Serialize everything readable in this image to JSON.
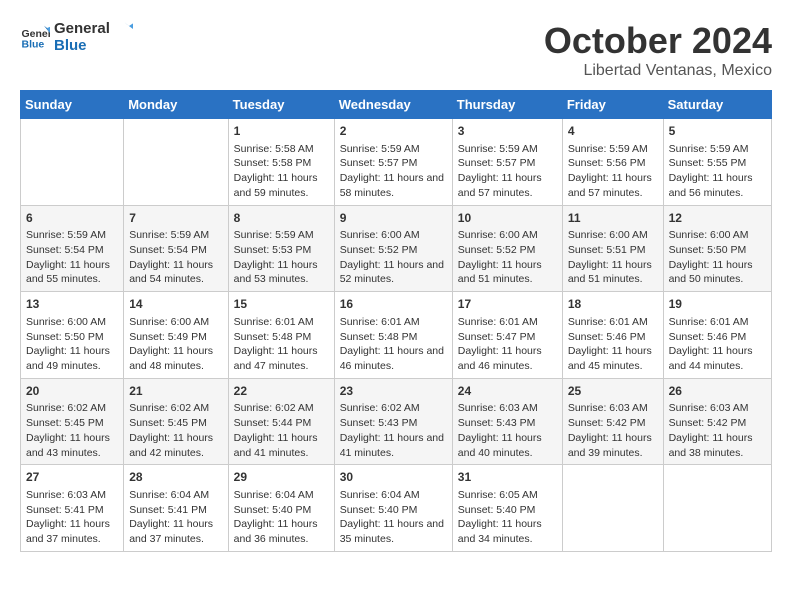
{
  "header": {
    "logo_general": "General",
    "logo_blue": "Blue",
    "month": "October 2024",
    "location": "Libertad Ventanas, Mexico"
  },
  "weekdays": [
    "Sunday",
    "Monday",
    "Tuesday",
    "Wednesday",
    "Thursday",
    "Friday",
    "Saturday"
  ],
  "weeks": [
    [
      {
        "day": "",
        "content": ""
      },
      {
        "day": "",
        "content": ""
      },
      {
        "day": "1",
        "content": "Sunrise: 5:58 AM\nSunset: 5:58 PM\nDaylight: 11 hours and 59 minutes."
      },
      {
        "day": "2",
        "content": "Sunrise: 5:59 AM\nSunset: 5:57 PM\nDaylight: 11 hours and 58 minutes."
      },
      {
        "day": "3",
        "content": "Sunrise: 5:59 AM\nSunset: 5:57 PM\nDaylight: 11 hours and 57 minutes."
      },
      {
        "day": "4",
        "content": "Sunrise: 5:59 AM\nSunset: 5:56 PM\nDaylight: 11 hours and 57 minutes."
      },
      {
        "day": "5",
        "content": "Sunrise: 5:59 AM\nSunset: 5:55 PM\nDaylight: 11 hours and 56 minutes."
      }
    ],
    [
      {
        "day": "6",
        "content": "Sunrise: 5:59 AM\nSunset: 5:54 PM\nDaylight: 11 hours and 55 minutes."
      },
      {
        "day": "7",
        "content": "Sunrise: 5:59 AM\nSunset: 5:54 PM\nDaylight: 11 hours and 54 minutes."
      },
      {
        "day": "8",
        "content": "Sunrise: 5:59 AM\nSunset: 5:53 PM\nDaylight: 11 hours and 53 minutes."
      },
      {
        "day": "9",
        "content": "Sunrise: 6:00 AM\nSunset: 5:52 PM\nDaylight: 11 hours and 52 minutes."
      },
      {
        "day": "10",
        "content": "Sunrise: 6:00 AM\nSunset: 5:52 PM\nDaylight: 11 hours and 51 minutes."
      },
      {
        "day": "11",
        "content": "Sunrise: 6:00 AM\nSunset: 5:51 PM\nDaylight: 11 hours and 51 minutes."
      },
      {
        "day": "12",
        "content": "Sunrise: 6:00 AM\nSunset: 5:50 PM\nDaylight: 11 hours and 50 minutes."
      }
    ],
    [
      {
        "day": "13",
        "content": "Sunrise: 6:00 AM\nSunset: 5:50 PM\nDaylight: 11 hours and 49 minutes."
      },
      {
        "day": "14",
        "content": "Sunrise: 6:00 AM\nSunset: 5:49 PM\nDaylight: 11 hours and 48 minutes."
      },
      {
        "day": "15",
        "content": "Sunrise: 6:01 AM\nSunset: 5:48 PM\nDaylight: 11 hours and 47 minutes."
      },
      {
        "day": "16",
        "content": "Sunrise: 6:01 AM\nSunset: 5:48 PM\nDaylight: 11 hours and 46 minutes."
      },
      {
        "day": "17",
        "content": "Sunrise: 6:01 AM\nSunset: 5:47 PM\nDaylight: 11 hours and 46 minutes."
      },
      {
        "day": "18",
        "content": "Sunrise: 6:01 AM\nSunset: 5:46 PM\nDaylight: 11 hours and 45 minutes."
      },
      {
        "day": "19",
        "content": "Sunrise: 6:01 AM\nSunset: 5:46 PM\nDaylight: 11 hours and 44 minutes."
      }
    ],
    [
      {
        "day": "20",
        "content": "Sunrise: 6:02 AM\nSunset: 5:45 PM\nDaylight: 11 hours and 43 minutes."
      },
      {
        "day": "21",
        "content": "Sunrise: 6:02 AM\nSunset: 5:45 PM\nDaylight: 11 hours and 42 minutes."
      },
      {
        "day": "22",
        "content": "Sunrise: 6:02 AM\nSunset: 5:44 PM\nDaylight: 11 hours and 41 minutes."
      },
      {
        "day": "23",
        "content": "Sunrise: 6:02 AM\nSunset: 5:43 PM\nDaylight: 11 hours and 41 minutes."
      },
      {
        "day": "24",
        "content": "Sunrise: 6:03 AM\nSunset: 5:43 PM\nDaylight: 11 hours and 40 minutes."
      },
      {
        "day": "25",
        "content": "Sunrise: 6:03 AM\nSunset: 5:42 PM\nDaylight: 11 hours and 39 minutes."
      },
      {
        "day": "26",
        "content": "Sunrise: 6:03 AM\nSunset: 5:42 PM\nDaylight: 11 hours and 38 minutes."
      }
    ],
    [
      {
        "day": "27",
        "content": "Sunrise: 6:03 AM\nSunset: 5:41 PM\nDaylight: 11 hours and 37 minutes."
      },
      {
        "day": "28",
        "content": "Sunrise: 6:04 AM\nSunset: 5:41 PM\nDaylight: 11 hours and 37 minutes."
      },
      {
        "day": "29",
        "content": "Sunrise: 6:04 AM\nSunset: 5:40 PM\nDaylight: 11 hours and 36 minutes."
      },
      {
        "day": "30",
        "content": "Sunrise: 6:04 AM\nSunset: 5:40 PM\nDaylight: 11 hours and 35 minutes."
      },
      {
        "day": "31",
        "content": "Sunrise: 6:05 AM\nSunset: 5:40 PM\nDaylight: 11 hours and 34 minutes."
      },
      {
        "day": "",
        "content": ""
      },
      {
        "day": "",
        "content": ""
      }
    ]
  ]
}
